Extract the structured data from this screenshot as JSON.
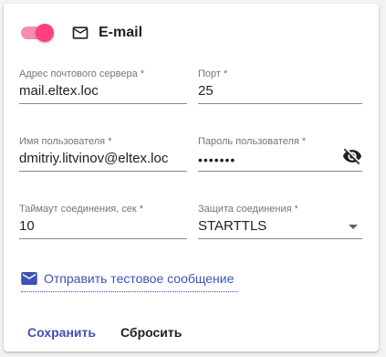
{
  "header": {
    "toggle_on": true,
    "icon": "envelope-outline-icon",
    "title": "E-mail"
  },
  "fields": {
    "server": {
      "label": "Адрес почтового сервера *",
      "value": "mail.eltex.loc"
    },
    "port": {
      "label": "Порт *",
      "value": "25"
    },
    "username": {
      "label": "Имя пользователя *",
      "value": "dmitriy.litvinov@eltex.loc"
    },
    "password": {
      "label": "Пароль пользователя *",
      "value": "•••••••",
      "visibility_icon": "eye-off-icon"
    },
    "timeout": {
      "label": "Таймаут соединения, сек *",
      "value": "10"
    },
    "security": {
      "label": "Защита соединения *",
      "value": "STARTTLS",
      "icon": "dropdown-arrow-icon"
    }
  },
  "test_link": {
    "icon": "envelope-filled-icon",
    "label": "Отправить тестовое сообщение"
  },
  "actions": {
    "save_label": "Сохранить",
    "reset_label": "Сбросить"
  },
  "colors": {
    "accent": "#3f51b5",
    "toggle_thumb": "#ff4081",
    "toggle_track": "#f48fb1"
  }
}
